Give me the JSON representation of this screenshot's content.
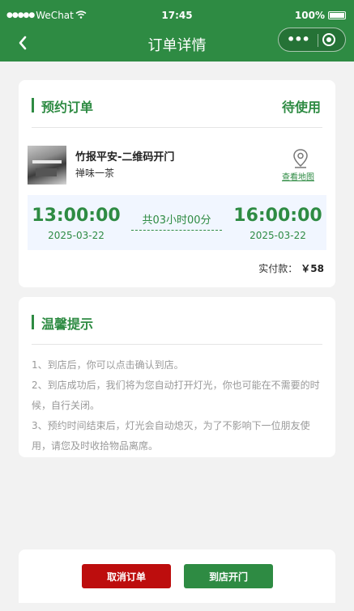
{
  "status_bar": {
    "carrier": "WeChat",
    "time": "17:45",
    "battery": "100%"
  },
  "nav": {
    "title": "订单详情"
  },
  "order": {
    "section_title": "预约订单",
    "status": "待使用",
    "store_name": "竹报平安-二维码开门",
    "store_sub": "禅味一茶",
    "map_link": "查看地图",
    "start_time": "13:00:00",
    "start_date": "2025-03-22",
    "duration": "共03小时00分",
    "end_time": "16:00:00",
    "end_date": "2025-03-22",
    "paid_label": "实付款：",
    "paid_amount": "￥58"
  },
  "tips": {
    "section_title": "温馨提示",
    "lines": [
      "1、到店后，你可以点击确认到店。",
      "2、到店成功后，我们将为您自动打开灯光，你也可能在不需要的时候，自行关闭。",
      "3、预约时间结束后，灯光会自动熄灭，为了不影响下一位朋友使用，请您及时收拾物品离席。"
    ]
  },
  "actions": {
    "cancel": "取消订单",
    "open": "到店开门"
  },
  "colors": {
    "primary": "#2e8b43",
    "danger": "#bd0d0d",
    "time_bg": "#f1f6ff"
  }
}
